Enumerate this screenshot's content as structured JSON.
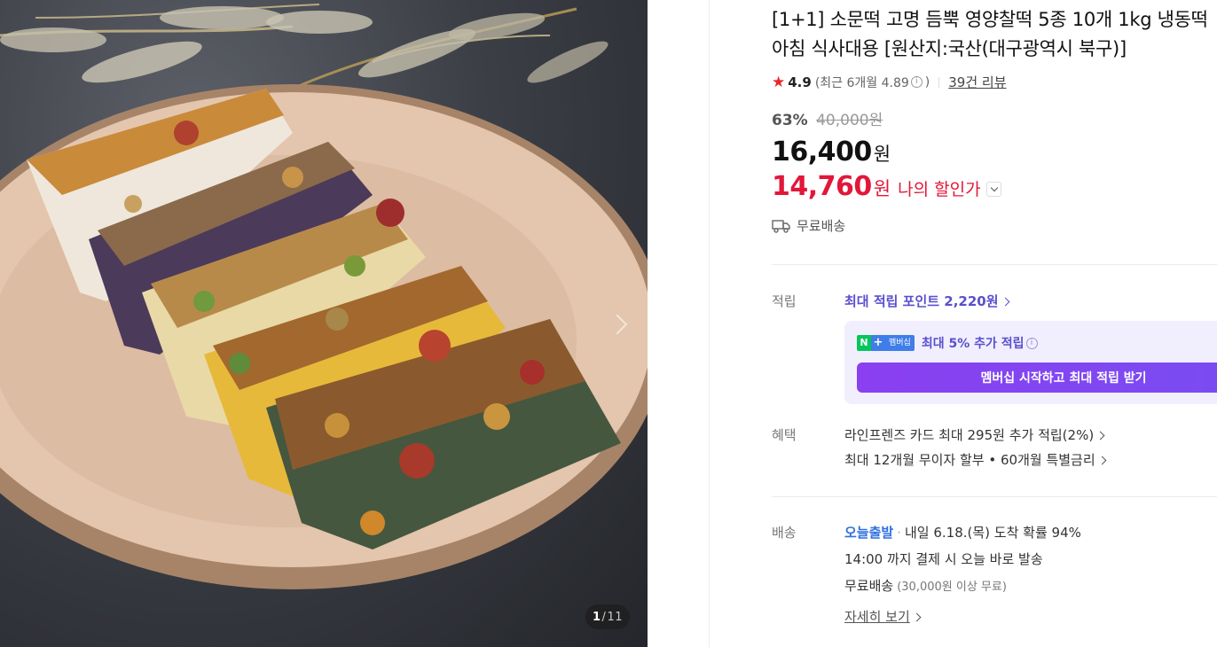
{
  "gallery": {
    "current": "1",
    "separator": "/",
    "total": "11"
  },
  "product": {
    "title_line1": "[1+1] 소문떡 고명 듬뿍 영양찰떡 5종 10개 1kg 냉동떡",
    "title_line2": "아침 식사대용 [원산지:국산(대구광역시 북구)]",
    "rating": "4.9",
    "rating_recent_prefix": "(최근 6개월 4.89",
    "rating_recent_suffix": ")",
    "review_count": "39건 리뷰",
    "discount_rate": "63%",
    "original_price": "40,000원",
    "sale_price": "16,400",
    "currency": "원",
    "my_price": "14,760",
    "my_price_label": "나의 할인가",
    "shipping": "무료배송"
  },
  "points": {
    "label": "적립",
    "max_point_link": "최대 적립 포인트 2,220원",
    "membership_badge_n": "N",
    "membership_badge_plus": "+",
    "membership_badge_text": "멤버십",
    "membership_text": "최대 5% 추가 적립",
    "membership_button": "멤버십 시작하고 최대 적립 받기"
  },
  "benefits": {
    "label": "혜택",
    "card": "라인프렌즈 카드 최대 295원 추가 적립(2%)",
    "installment": "최대 12개월 무이자 할부 • 60개월 특별금리"
  },
  "delivery": {
    "label": "배송",
    "today": "오늘출발",
    "arrival": "내일 6.18.(목) 도착 확률 94%",
    "cutoff": "14:00 까지 결제 시 오늘 바로 발송",
    "free": "무료배송",
    "free_condition": "(30,000원 이상 무료)",
    "detail_link": "자세히 보기"
  },
  "colors": {
    "accent_red": "#e21739",
    "point_purple": "#5a4fcf",
    "today_blue": "#2f6fe0",
    "star": "#e8262a"
  },
  "icons": [
    "star-icon",
    "info-icon",
    "truck-icon",
    "chevron-right-icon",
    "chevron-down-icon"
  ]
}
